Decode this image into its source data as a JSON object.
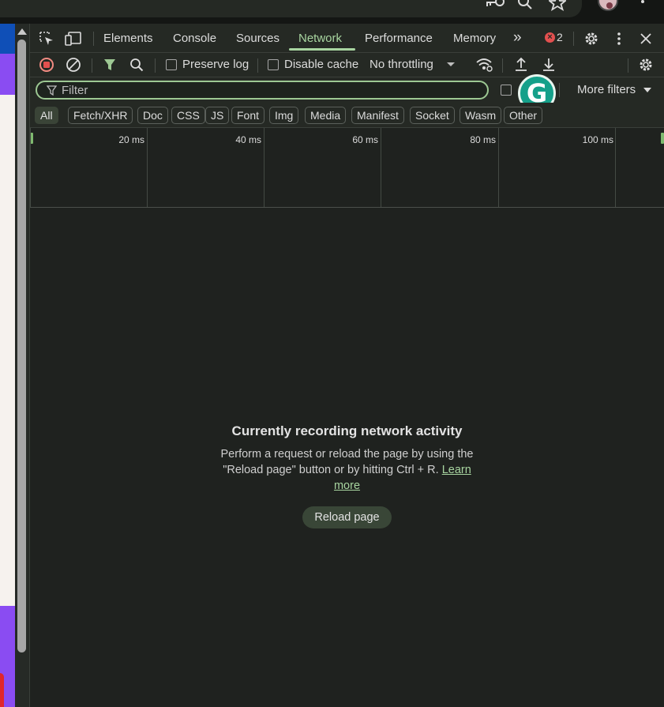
{
  "devtools": {
    "tabs": [
      {
        "label": "Elements"
      },
      {
        "label": "Console"
      },
      {
        "label": "Sources"
      },
      {
        "label": "Network",
        "active": true
      },
      {
        "label": "Performance"
      },
      {
        "label": "Memory"
      }
    ],
    "more_tabs_label": "»",
    "error_count": "2",
    "accent_color": "#a8d5a0"
  },
  "toolbar": {
    "preserve_log_label": "Preserve log",
    "disable_cache_label": "Disable cache",
    "throttling_value": "No throttling"
  },
  "filter": {
    "placeholder": "Filter",
    "more_filters_label": "More filters"
  },
  "grammarly": {
    "letter": "G"
  },
  "type_filters": [
    "All",
    "Fetch/XHR",
    "Doc",
    "CSS",
    "JS",
    "Font",
    "Img",
    "Media",
    "Manifest",
    "Socket",
    "Wasm",
    "Other"
  ],
  "timeline": {
    "ticks": [
      "20 ms",
      "40 ms",
      "60 ms",
      "80 ms",
      "100 ms"
    ]
  },
  "empty_state": {
    "title": "Currently recording network activity",
    "description": "Perform a request or reload the page by using the \"Reload page\" button or by hitting Ctrl + R.",
    "link_label": "Learn more",
    "button_label": "Reload page"
  }
}
